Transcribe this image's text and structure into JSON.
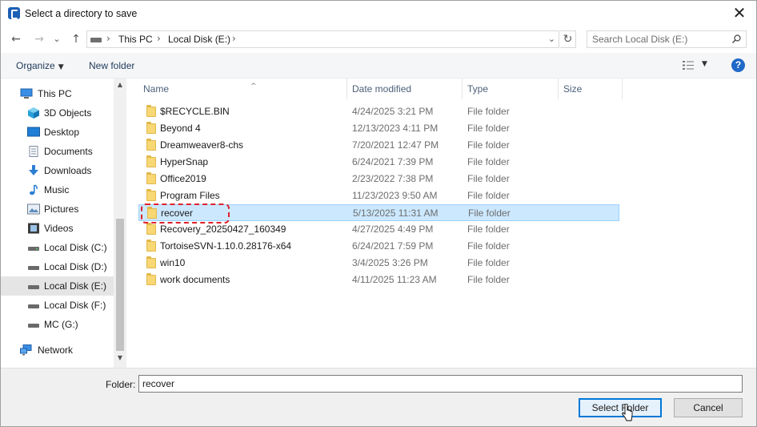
{
  "window": {
    "title": "Select a directory to save",
    "close_glyph": "✕"
  },
  "nav": {
    "back_glyph": "←",
    "forward_glyph": "→",
    "recent_glyph": "⌄",
    "up_glyph": "↑",
    "breadcrumb": [
      "This PC",
      "Local Disk (E:)"
    ],
    "sep_glyph": "›",
    "dropdown_glyph": "⌄",
    "refresh_glyph": "↻",
    "search_placeholder": "Search Local Disk (E:)"
  },
  "toolbar": {
    "organize_label": "Organize",
    "organize_caret": "▼",
    "new_folder_label": "New folder",
    "view_caret": "▼",
    "help_label": "?"
  },
  "sidebar": {
    "items": [
      {
        "label": "This PC",
        "icon": "pc-icon"
      },
      {
        "label": "3D Objects",
        "icon": "cube-icon"
      },
      {
        "label": "Desktop",
        "icon": "desktop-icon"
      },
      {
        "label": "Documents",
        "icon": "document-icon"
      },
      {
        "label": "Downloads",
        "icon": "download-icon"
      },
      {
        "label": "Music",
        "icon": "music-icon"
      },
      {
        "label": "Pictures",
        "icon": "pictures-icon"
      },
      {
        "label": "Videos",
        "icon": "video-icon"
      },
      {
        "label": "Local Disk (C:)",
        "icon": "drive-icon"
      },
      {
        "label": "Local Disk (D:)",
        "icon": "drive-icon"
      },
      {
        "label": "Local Disk (E:)",
        "icon": "drive-icon",
        "selected": true
      },
      {
        "label": "Local Disk (F:)",
        "icon": "drive-icon"
      },
      {
        "label": "MC (G:)",
        "icon": "drive-icon"
      },
      {
        "label": "Network",
        "icon": "network-icon"
      }
    ],
    "scroll_up_glyph": "▲",
    "scroll_down_glyph": "▼"
  },
  "filelist": {
    "columns": {
      "name": "Name",
      "date": "Date modified",
      "type": "Type",
      "size": "Size"
    },
    "sort_glyph": "^",
    "rows": [
      {
        "name": "$RECYCLE.BIN",
        "date": "4/24/2025 3:21 PM",
        "type": "File folder"
      },
      {
        "name": "Beyond 4",
        "date": "12/13/2023 4:11 PM",
        "type": "File folder"
      },
      {
        "name": "Dreamweaver8-chs",
        "date": "7/20/2021 12:47 PM",
        "type": "File folder"
      },
      {
        "name": "HyperSnap",
        "date": "6/24/2021 7:39 PM",
        "type": "File folder"
      },
      {
        "name": "Office2019",
        "date": "2/23/2022 7:38 PM",
        "type": "File folder"
      },
      {
        "name": "Program Files",
        "date": "11/23/2023 9:50 AM",
        "type": "File folder"
      },
      {
        "name": "recover",
        "date": "5/13/2025 11:31 AM",
        "type": "File folder",
        "selected": true
      },
      {
        "name": "Recovery_20250427_160349",
        "date": "4/27/2025 4:49 PM",
        "type": "File folder"
      },
      {
        "name": "TortoiseSVN-1.10.0.28176-x64",
        "date": "6/24/2021 7:59 PM",
        "type": "File folder"
      },
      {
        "name": "win10",
        "date": "3/4/2025 3:26 PM",
        "type": "File folder"
      },
      {
        "name": "work documents",
        "date": "4/11/2025 11:23 AM",
        "type": "File folder"
      }
    ]
  },
  "footer": {
    "folder_label": "Folder:",
    "folder_value": "recover",
    "select_button": "Select Folder",
    "cancel_button": "Cancel"
  },
  "colors": {
    "accent": "#0078d7",
    "selection": "#cce8ff",
    "highlight_annotation": "#e0202a",
    "folder": "#f8d775"
  }
}
